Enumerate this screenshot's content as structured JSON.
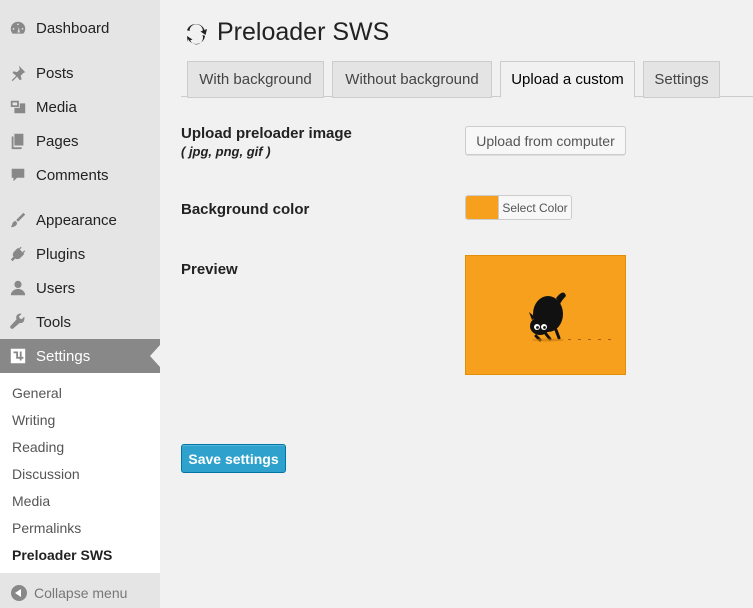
{
  "sidebar": {
    "items": [
      {
        "label": "Dashboard",
        "icon": "dashboard-icon"
      },
      {
        "label": "Posts",
        "icon": "pin-icon"
      },
      {
        "label": "Media",
        "icon": "media-icon"
      },
      {
        "label": "Pages",
        "icon": "pages-icon"
      },
      {
        "label": "Comments",
        "icon": "comment-icon"
      },
      {
        "label": "Appearance",
        "icon": "brush-icon"
      },
      {
        "label": "Plugins",
        "icon": "plug-icon"
      },
      {
        "label": "Users",
        "icon": "user-icon"
      },
      {
        "label": "Tools",
        "icon": "wrench-icon"
      },
      {
        "label": "Settings",
        "icon": "settings-icon"
      }
    ],
    "submenu": [
      "General",
      "Writing",
      "Reading",
      "Discussion",
      "Media",
      "Permalinks",
      "Preloader SWS"
    ],
    "collapse_label": "Collapse menu"
  },
  "page": {
    "title": "Preloader SWS",
    "tabs": [
      "With background",
      "Without background",
      "Upload a custom",
      "Settings"
    ],
    "active_tab": "Upload a custom",
    "upload_label": "Upload preloader image",
    "upload_hint": "( jpg, png, gif )",
    "upload_button": "Upload from computer",
    "bg_color_label": "Background color",
    "select_color": "Select Color",
    "bg_color": "#f7a01d",
    "preview_label": "Preview",
    "save_button": "Save settings"
  }
}
